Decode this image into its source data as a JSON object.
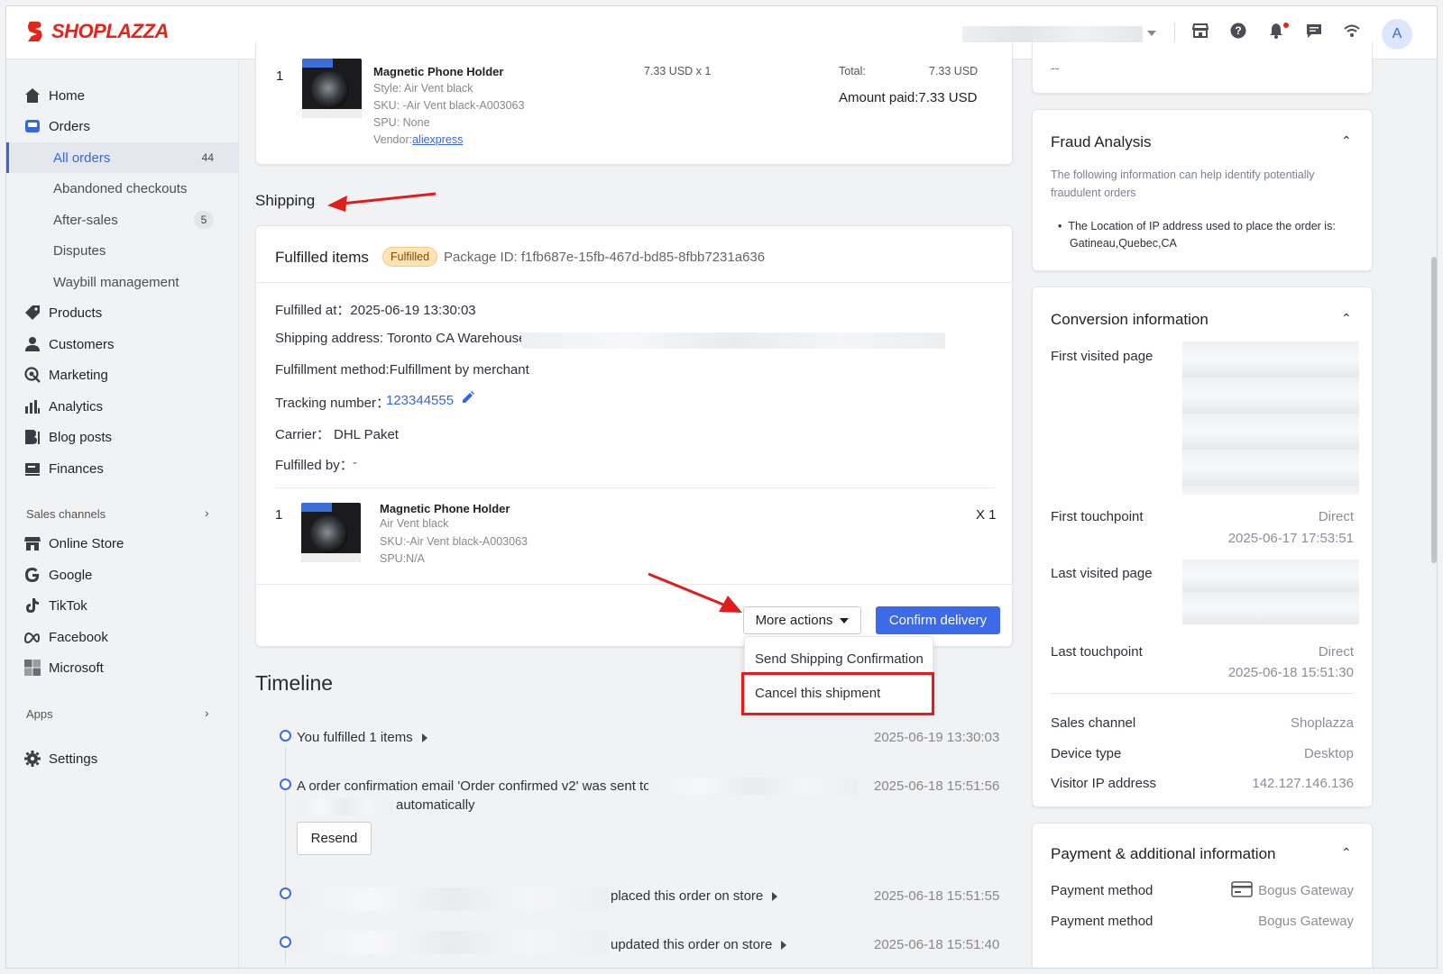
{
  "topbar": {
    "brand": "SHOPLAZZA",
    "avatar_letter": "A",
    "icons": [
      "store-icon",
      "help-icon",
      "bell-icon",
      "chat-icon",
      "wifi-icon"
    ]
  },
  "sidebar": {
    "items": [
      {
        "label": "Home",
        "icon": "home-icon"
      },
      {
        "label": "Orders",
        "icon": "orders-icon"
      },
      {
        "label": "All orders",
        "count": "44"
      },
      {
        "label": "Abandoned checkouts"
      },
      {
        "label": "After-sales",
        "count": "5"
      },
      {
        "label": "Disputes"
      },
      {
        "label": "Waybill management"
      },
      {
        "label": "Products",
        "icon": "tag-icon"
      },
      {
        "label": "Customers",
        "icon": "user-icon"
      },
      {
        "label": "Marketing",
        "icon": "marketing-icon"
      },
      {
        "label": "Analytics",
        "icon": "analytics-icon"
      },
      {
        "label": "Blog posts",
        "icon": "blog-icon"
      },
      {
        "label": "Finances",
        "icon": "finance-icon"
      }
    ],
    "sales_channels_label": "Sales channels",
    "channels": [
      {
        "label": "Online Store",
        "icon": "store-icon"
      },
      {
        "label": "Google",
        "icon": "google-icon"
      },
      {
        "label": "TikTok",
        "icon": "tiktok-icon"
      },
      {
        "label": "Facebook",
        "icon": "meta-icon"
      },
      {
        "label": "Microsoft",
        "icon": "microsoft-icon"
      }
    ],
    "apps_label": "Apps",
    "settings_label": "Settings"
  },
  "order_item": {
    "index": "1",
    "name": "Magnetic Phone Holder",
    "style": "Style: Air Vent black",
    "sku": "SKU: -Air Vent black-A003063",
    "spu": "SPU: None",
    "vendor_prefix": "Vendor:",
    "vendor_link": "aliexpress",
    "qty_price": "7.33 USD x 1",
    "total_label": "Total:",
    "total_value": "7.33 USD",
    "amount_paid": "Amount paid:7.33 USD"
  },
  "shipping": {
    "heading": "Shipping",
    "fulfilled_items_title": "Fulfilled items",
    "status_badge": "Fulfilled",
    "package_id": "Package ID: f1fb687e-15fb-467d-bd85-8fbb7231a636",
    "fulfilled_at": "Fulfilled at：2025-06-19 13:30:03",
    "shipping_address": "Shipping address: Toronto CA Warehouse",
    "fulfillment_method": "Fulfillment method:Fulfillment by merchant",
    "tracking_label": "Tracking number：",
    "tracking_number": "123344555",
    "carrier": "Carrier：  DHL Paket",
    "fulfilled_by_label": "Fulfilled by：",
    "fulfilled_by_value": "-",
    "item": {
      "index": "1",
      "name": "Magnetic Phone Holder",
      "variant": "Air Vent black",
      "sku": "SKU:-Air Vent black-A003063",
      "spu": "SPU:N/A",
      "qty": "X 1"
    },
    "more_actions": "More actions",
    "confirm_delivery": "Confirm delivery",
    "menu": {
      "send_confirmation": "Send Shipping Confirmation",
      "cancel_shipment": "Cancel this shipment"
    }
  },
  "timeline": {
    "heading": "Timeline",
    "events": [
      {
        "text": "You fulfilled 1 items",
        "time": "2025-06-19 13:30:03"
      },
      {
        "text": "A order confirmation email 'Order confirmed v2' was sent to",
        "text2": "automatically",
        "time": "2025-06-18 15:51:56",
        "button": "Resend"
      },
      {
        "text": "placed this order on store",
        "time": "2025-06-18 15:51:55"
      },
      {
        "text": "updated this order on store",
        "time": "2025-06-18 15:51:40"
      }
    ]
  },
  "right": {
    "top_value": "--",
    "fraud": {
      "title": "Fraud Analysis",
      "desc_line1": "The following information can help identify potentially",
      "desc_line2": "fraudulent orders",
      "bullet_line1": "The Location of IP address used to place the order is:",
      "bullet_line2": "Gatineau,Quebec,CA"
    },
    "conversion": {
      "title": "Conversion information",
      "first_visited_label": "First visited page",
      "first_touch_label": "First touchpoint",
      "first_touch_value": "Direct",
      "first_touch_time": "2025-06-17 17:53:51",
      "last_visited_label": "Last visited page",
      "last_touch_label": "Last touchpoint",
      "last_touch_value": "Direct",
      "last_touch_time": "2025-06-18 15:51:30",
      "sales_channel_label": "Sales channel",
      "sales_channel_value": "Shoplazza",
      "device_label": "Device type",
      "device_value": "Desktop",
      "ip_label": "Visitor IP address",
      "ip_value": "142.127.146.136"
    },
    "payment": {
      "title": "Payment & additional information",
      "method_label": "Payment method",
      "method_value": "Bogus Gateway",
      "method_label2": "Payment method",
      "method_value2": "Bogus Gateway"
    }
  },
  "colors": {
    "accent": "#3c6ae8",
    "brand": "#e1251b",
    "annotation": "#e01c1c",
    "badge_bg": "#fde3b6"
  }
}
